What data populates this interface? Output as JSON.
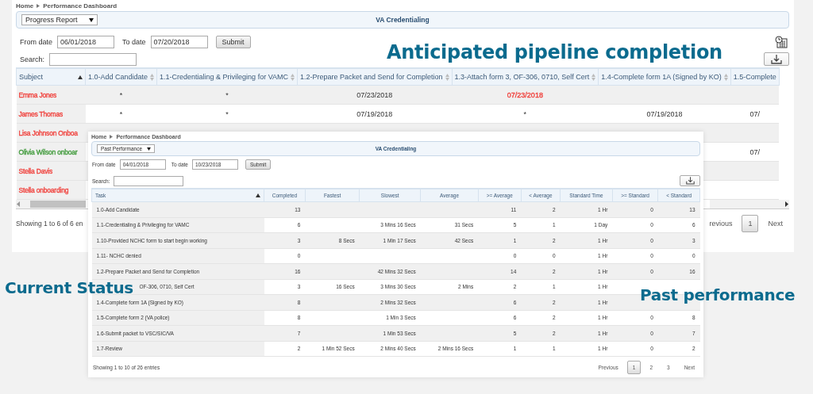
{
  "back": {
    "breadcrumb": [
      "Home",
      "Performance Dashboard"
    ],
    "report_select": "Progress Report",
    "title": "VA Credentialing",
    "from_label": "From date",
    "from_value": "06/01/2018",
    "to_label": "To date",
    "to_value": "07/20/2018",
    "submit": "Submit",
    "search_label": "Search:",
    "columns": [
      {
        "label": "Subject",
        "sorted": true
      },
      {
        "label": "1.0-Add Candidate",
        "sorted": false
      },
      {
        "label": "1.1-Credentialing & Privileging for VAMC",
        "sorted": false
      },
      {
        "label": "1.2-Prepare Packet and Send for Completion",
        "sorted": false
      },
      {
        "label": "1.3-Attach form 3, OF-306, 0710, Self Cert",
        "sorted": false
      },
      {
        "label": "1.4-Complete form 1A (Signed by KO)",
        "sorted": false
      },
      {
        "label": "1.5-Complete",
        "sorted": false
      }
    ],
    "rows": [
      {
        "cells": [
          {
            "text": "Emma Jones",
            "color": "#f0413c"
          },
          {
            "text": "*"
          },
          {
            "text": "*"
          },
          {
            "text": "07/23/2018"
          },
          {
            "text": "07/23/2018",
            "color": "#f0413c"
          }
        ]
      },
      {
        "cells": [
          {
            "text": "James Thomas",
            "color": "#f0413c"
          },
          {
            "text": "*"
          },
          {
            "text": "*"
          },
          {
            "text": "07/19/2018"
          },
          {
            "text": "*"
          },
          {
            "text": "07/19/2018"
          },
          {
            "text": "07/"
          }
        ]
      },
      {
        "cells": [
          {
            "text": "Lisa Johnson Onboa",
            "color": "#f0413c"
          }
        ]
      },
      {
        "cells": [
          {
            "text": "Olivia Wilson onboar",
            "color": "#3f9a3a"
          },
          null,
          null,
          null,
          null,
          null,
          {
            "text": "07/"
          }
        ]
      },
      {
        "cells": [
          {
            "text": "Stella Davis",
            "color": "#f0413c"
          }
        ]
      },
      {
        "cells": [
          {
            "text": "Stella onboarding",
            "color": "#f0413c"
          }
        ]
      }
    ],
    "footer": "Showing 1 to 6 of 6 en",
    "pages": [
      {
        "label": "revious",
        "selected": false
      },
      {
        "label": "1",
        "selected": true
      },
      {
        "label": "Next",
        "selected": false
      }
    ]
  },
  "front": {
    "breadcrumb": [
      "Home",
      "Performance Dashboard"
    ],
    "report_select": "Past Performance",
    "title": "VA Credentialing",
    "from_label": "From date",
    "from_value": "04/01/2018",
    "to_label": "To date",
    "to_value": "10/23/2018",
    "submit": "Submit",
    "search_label": "Search:",
    "columns": [
      {
        "label": "Task",
        "sorted": true
      },
      {
        "label": "Completed",
        "sorted": false
      },
      {
        "label": "Fastest",
        "sorted": false
      },
      {
        "label": "Slowest",
        "sorted": false
      },
      {
        "label": "Average",
        "sorted": false
      },
      {
        "label": ">= Average",
        "sorted": false
      },
      {
        "label": "< Average",
        "sorted": false
      },
      {
        "label": "Standard Time",
        "sorted": false
      },
      {
        "label": ">= Standard",
        "sorted": false
      },
      {
        "label": "< Standard",
        "sorted": false
      }
    ],
    "rows": [
      {
        "covered_start": false,
        "cells": [
          "1.0-Add Candidate",
          "13",
          null,
          null,
          null,
          "11",
          "2",
          "1 Hr",
          "0",
          "13"
        ]
      },
      {
        "covered_start": false,
        "cells": [
          "1.1-Credentialing & Privileging for VAMC",
          "6",
          null,
          "3 Mins 16 Secs",
          "31 Secs",
          "5",
          "1",
          "1 Day",
          "0",
          "6"
        ]
      },
      {
        "covered_start": false,
        "cells": [
          "1.10-Provided NCHC form to start begin working",
          "3",
          "8 Secs",
          "1 Min 17 Secs",
          "42 Secs",
          "1",
          "2",
          "1 Hr",
          "0",
          "3"
        ]
      },
      {
        "covered_start": false,
        "cells": [
          "1.11- NCHC denied",
          "0",
          null,
          null,
          null,
          "0",
          "0",
          "1 Hr",
          "0",
          "0"
        ]
      },
      {
        "covered_start": false,
        "cells": [
          "1.2-Prepare Packet and Send for Completion",
          "16",
          null,
          "42 Mins 32 Secs",
          null,
          "14",
          "2",
          "1 Hr",
          "0",
          "16"
        ]
      },
      {
        "covered_start": true,
        "cells": [
          "OF-306, 0710, Self Cert",
          "3",
          "16 Secs",
          "3 Mins 30 Secs",
          "2 Mins",
          "2",
          "1",
          "1 Hr",
          null,
          null
        ]
      },
      {
        "covered_start": false,
        "cells": [
          "1.4-Complete form 1A (Signed by KO)",
          "8",
          null,
          "2 Mins 32 Secs",
          null,
          "6",
          "2",
          "1 Hr",
          null,
          null
        ]
      },
      {
        "covered_start": false,
        "cells": [
          "1.5-Complete form 2 (VA police)",
          "8",
          null,
          "1 Min 3 Secs",
          null,
          "6",
          "2",
          "1 Hr",
          "0",
          "8"
        ]
      },
      {
        "covered_start": false,
        "cells": [
          "1.6-Submit packet to VSC/SIC/VA",
          "7",
          null,
          "1 Min 53 Secs",
          null,
          "5",
          "2",
          "1 Hr",
          "0",
          "7"
        ]
      },
      {
        "covered_start": false,
        "cells": [
          "1.7-Review",
          "2",
          "1 Min 52 Secs",
          "2 Mins 40 Secs",
          "2 Mins 16 Secs",
          "1",
          "1",
          "1 Hr",
          "0",
          "2"
        ]
      }
    ],
    "footer": "Showing 1 to 10 of 26 entries",
    "pages": [
      {
        "label": "Previous",
        "selected": false
      },
      {
        "label": "1",
        "selected": true
      },
      {
        "label": "2",
        "selected": false
      },
      {
        "label": "3",
        "selected": false
      },
      {
        "label": "Next",
        "selected": false
      }
    ]
  },
  "callouts": [
    "Anticipated pipeline completion",
    "Current Status",
    "Past performance"
  ]
}
